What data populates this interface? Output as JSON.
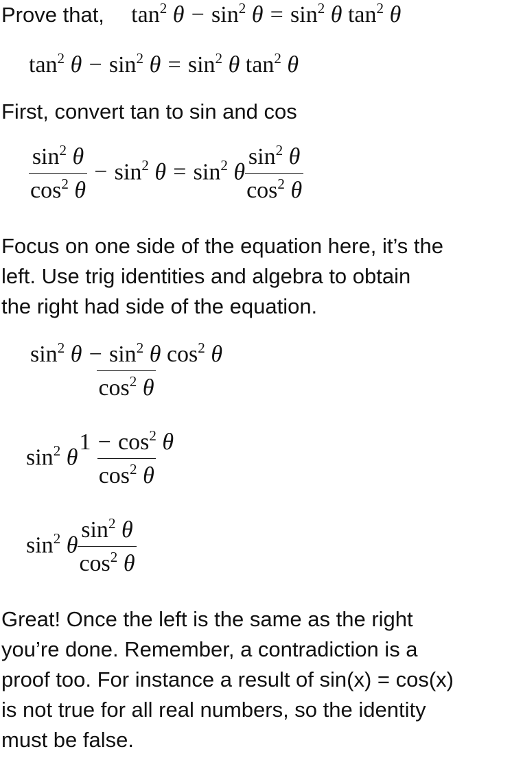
{
  "intro": {
    "prove_label": "Prove that,",
    "identity": {
      "tan": "tan",
      "sin": "sin",
      "sq": "2",
      "theta": "θ",
      "minus": "−",
      "equals": "="
    }
  },
  "line_first": "First, convert tan to sin and cos",
  "paragraph_focus": [
    "Focus on one side of the equation here, it’s the",
    "left. Use trig identities and algebra to obtain",
    "the right had side of the equation."
  ],
  "math": {
    "sin": "sin",
    "cos": "cos",
    "tan": "tan",
    "sq": "2",
    "theta": "θ",
    "minus": "−",
    "equals": "=",
    "one": "1"
  },
  "paragraph_conclusion": [
    "Great! Once the left is the same as the right",
    "you’re done. Remember, a contradiction is a",
    "proof too. For instance a result of sin(x) = cos(x)",
    "is not true for all real numbers, so the identity",
    "must be false."
  ]
}
